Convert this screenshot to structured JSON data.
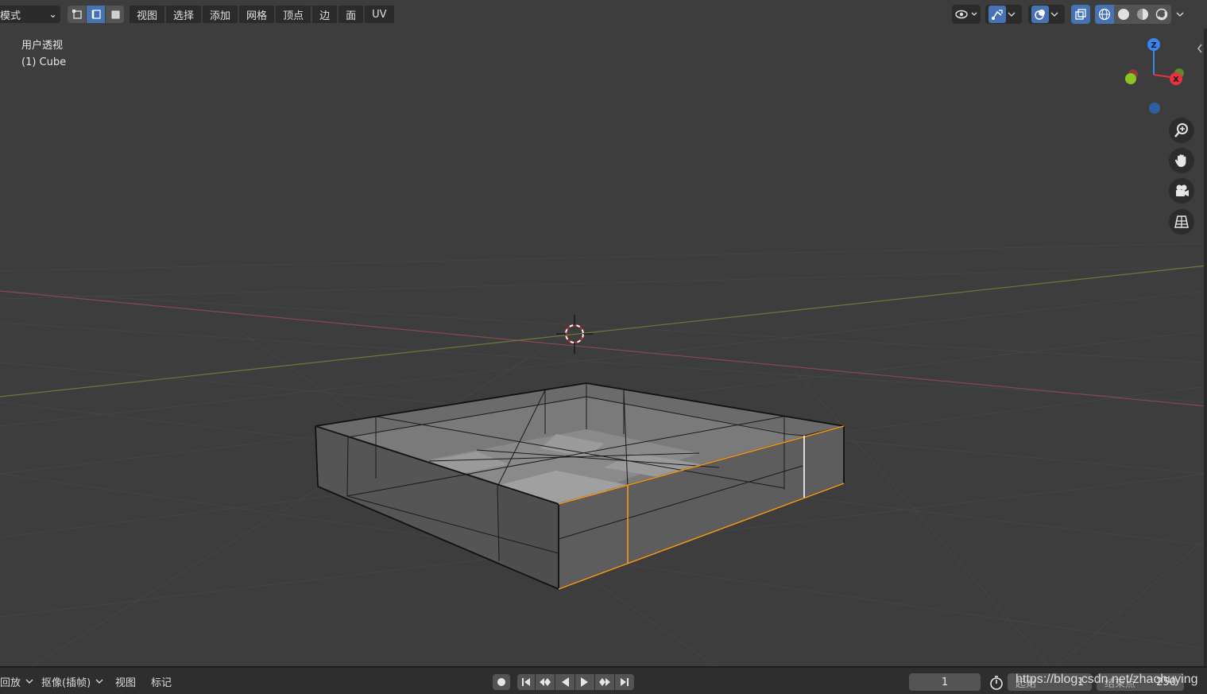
{
  "header": {
    "mode_label": "模式",
    "menus": [
      "视图",
      "选择",
      "添加",
      "网格",
      "顶点",
      "边",
      "面",
      "UV"
    ]
  },
  "viewport": {
    "view_name": "用户透视",
    "object_label": "(1) Cube",
    "gizmo_axes": {
      "z": "Z",
      "x": "X"
    }
  },
  "timeline": {
    "playback_label": "回放",
    "keying_label": "抠像(插帧)",
    "view_label": "视图",
    "marker_label": "标记",
    "current_frame": "1",
    "start_label": "起始",
    "start_value": "1",
    "end_label": "结束点",
    "end_value": "250"
  },
  "watermark": "https://blog.csdn.net/zhaohuying",
  "colors": {
    "background": "#3d3d3d",
    "accent_blue": "#4772b3",
    "selected_edge": "#f29a1f",
    "axis_x": "#a8474f",
    "axis_y": "#7c9a3a"
  }
}
